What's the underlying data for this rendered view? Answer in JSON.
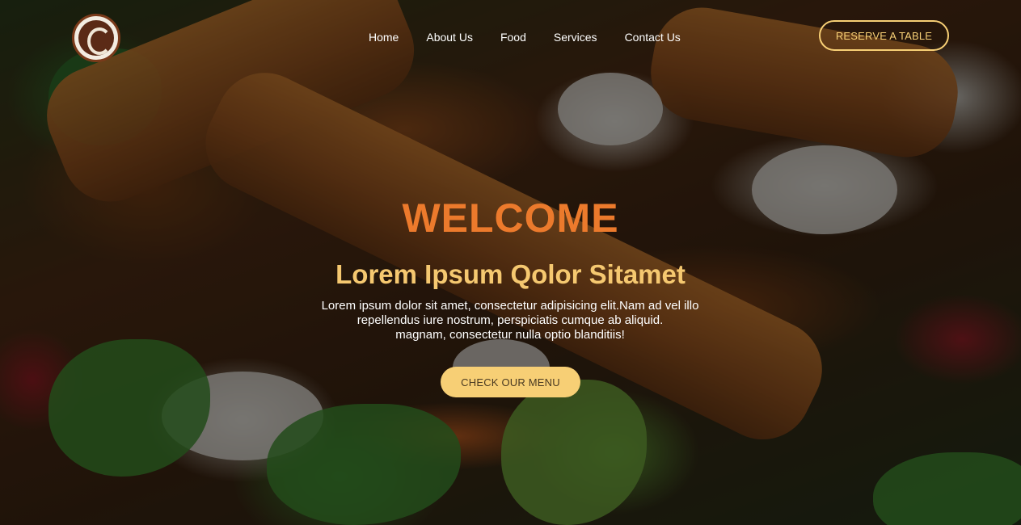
{
  "header": {
    "nav": [
      {
        "label": "Home"
      },
      {
        "label": "About Us"
      },
      {
        "label": "Food"
      },
      {
        "label": "Services"
      },
      {
        "label": "Contact Us"
      }
    ],
    "reserve_label": "RESERVE A TABLE"
  },
  "hero": {
    "welcome": "WELCOME",
    "subtitle": "Lorem Ipsum Qolor Sitamet",
    "description_lines": [
      "Lorem ipsum dolor sit amet, consectetur adipisicing elit.Nam ad vel illo",
      "repellendus iure nostrum, perspiciatis cumque ab aliquid.",
      "magnam, consectetur nulla optio blanditiis!"
    ],
    "cta_label": "CHECK OUR MENU"
  },
  "colors": {
    "accent": "#f7cf75",
    "welcome": "#ec7a2c",
    "subtitle": "#f5c870"
  },
  "icons": {
    "logo": "restaurant-logo-icon"
  }
}
